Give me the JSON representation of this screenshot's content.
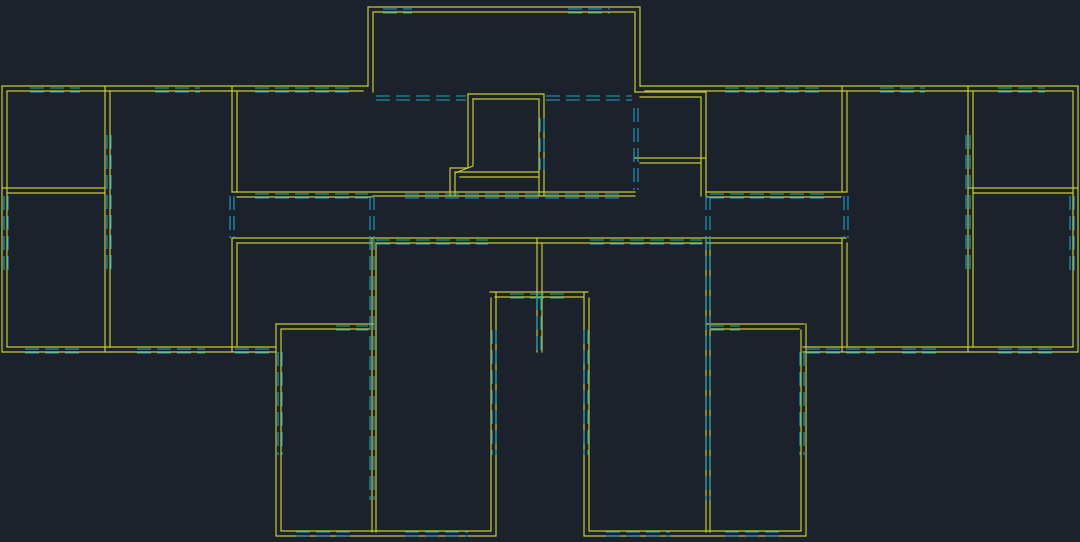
{
  "view": {
    "type": "cad-floor-plan",
    "background_color": "#1b222c",
    "wall_color": "#c8c832",
    "opening_color": "#1fa3c4",
    "wall_style": "double-line with inner offset",
    "opening_style": "dashed double-line"
  },
  "plan": {
    "symmetry": "left-right",
    "text_labels": [],
    "zones": [
      "north-annex",
      "west-wing",
      "east-wing",
      "central-corridor",
      "south-left-block",
      "south-center-block",
      "south-right-block"
    ]
  }
}
